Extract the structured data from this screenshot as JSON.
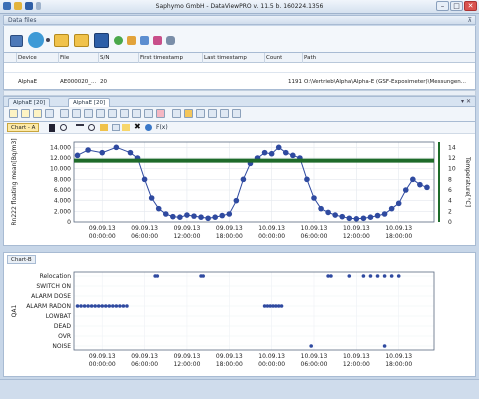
{
  "window": {
    "title": "Saphymo GmbH - DataViewPRO v. 11.5 b. 160224.1356"
  },
  "panel": {
    "title": "Data files",
    "pin": "⊼"
  },
  "file_table": {
    "headers": [
      "Device",
      "File",
      "S/N",
      "First timestamp",
      "Last timestamp",
      "Count",
      "Path"
    ],
    "row": {
      "device": "AlphaE",
      "file": "AE000020_...",
      "sn": "20",
      "count": "1191",
      "path": "O:\\Vertrieb\\Alpha\\Alpha-E (GSF-Exposimeter)\\Messungen..."
    }
  },
  "tabs": [
    "AlphaE [20]",
    "AlphaE [20]"
  ],
  "tab_ctrl": "▾ ✕",
  "chartA_toolbar": {
    "label": "Chart - A",
    "close": "✖",
    "fx": "F(x)"
  },
  "chartB_label": "Chart-B",
  "chart_data": [
    {
      "type": "line",
      "title": "Chart - A",
      "ylabel": "Rn222 floating mean[Bq/m3]",
      "y2label": "Temperature[°C]",
      "yticks": [
        0,
        2000,
        4000,
        6000,
        8000,
        10000,
        12000,
        14000
      ],
      "ytick_labels": [
        "0",
        "2.000",
        "4.000",
        "6.000",
        "8.000",
        "10.000",
        "12.000",
        "14.000"
      ],
      "y2ticks": [
        0,
        2,
        4,
        6,
        8,
        10,
        12,
        14
      ],
      "ylim": [
        0,
        15000
      ],
      "y2lim": [
        0,
        15
      ],
      "xticks": [
        "09.09.13\n00:00:00",
        "09.09.13\n06:00:00",
        "09.09.13\n12:00:00",
        "09.09.13\n18:00:00",
        "10.09.13\n00:00:00",
        "10.09.13\n06:00:00",
        "10.09.13\n12:00:00",
        "10.09.13\n18:00:00"
      ],
      "x_hours": [
        0,
        6,
        12,
        18,
        24,
        30,
        36,
        42
      ],
      "xlim_hours": [
        -4,
        47
      ],
      "series": [
        {
          "name": "Rn222 floating mean",
          "axis": "left",
          "color": "#2f4aa0",
          "x_hours": [
            -3.5,
            -2,
            0,
            2,
            4,
            5,
            6,
            7,
            8,
            9,
            10,
            11,
            12,
            13,
            14,
            15,
            16,
            17,
            18,
            19,
            20,
            21,
            22,
            23,
            24,
            25,
            26,
            27,
            28,
            29,
            30,
            31,
            32,
            33,
            34,
            35,
            36,
            37,
            38,
            39,
            40,
            41,
            42,
            43,
            44,
            45,
            46
          ],
          "values": [
            12500,
            13500,
            13000,
            14000,
            13000,
            12000,
            8000,
            4500,
            2500,
            1500,
            1000,
            900,
            1300,
            1100,
            900,
            700,
            900,
            1200,
            1500,
            4000,
            8000,
            11000,
            12000,
            13000,
            12800,
            14000,
            13000,
            12500,
            12000,
            8000,
            4500,
            2500,
            1800,
            1300,
            1000,
            700,
            600,
            700,
            900,
            1200,
            1500,
            2500,
            3500,
            6000,
            8000,
            7000,
            6500
          ]
        },
        {
          "name": "Temperature",
          "axis": "right",
          "color": "#1e6b2a",
          "x_hours": [
            -4,
            47
          ],
          "values": [
            11.5,
            11.5
          ]
        }
      ]
    },
    {
      "type": "scatter",
      "title": "Chart-B",
      "ylabel": "QA1",
      "categories": [
        "Relocation",
        "SWITCH ON",
        "ALARM DOSE",
        "ALARM RADON",
        "LOWBAT",
        "DEAD",
        "OVR",
        "NOISE"
      ],
      "xticks": [
        "09.09.13\n00:00:00",
        "09.09.13\n06:00:00",
        "09.09.13\n12:00:00",
        "09.09.13\n18:00:00",
        "10.09.13\n00:00:00",
        "10.09.13\n06:00:00",
        "10.09.13\n12:00:00",
        "10.09.13\n18:00:00"
      ],
      "x_hours": [
        0,
        6,
        12,
        18,
        24,
        30,
        36,
        42
      ],
      "xlim_hours": [
        -4,
        47
      ],
      "color": "#2f4aa0",
      "events": [
        {
          "category": "Relocation",
          "x_hours": [
            7.5,
            7.8,
            14,
            14.3,
            32,
            32.4,
            35,
            37,
            38,
            39,
            40,
            41,
            42
          ]
        },
        {
          "category": "ALARM RADON",
          "x_hours": [
            -3.5,
            -3,
            -2.5,
            -2,
            -1.5,
            -1,
            -0.5,
            0,
            0.5,
            1,
            1.5,
            2,
            2.5,
            3,
            3.5,
            23,
            23.4,
            23.8,
            24.2,
            24.6,
            25,
            25.4
          ]
        },
        {
          "category": "NOISE",
          "x_hours": [
            29.6,
            40
          ]
        }
      ]
    }
  ]
}
